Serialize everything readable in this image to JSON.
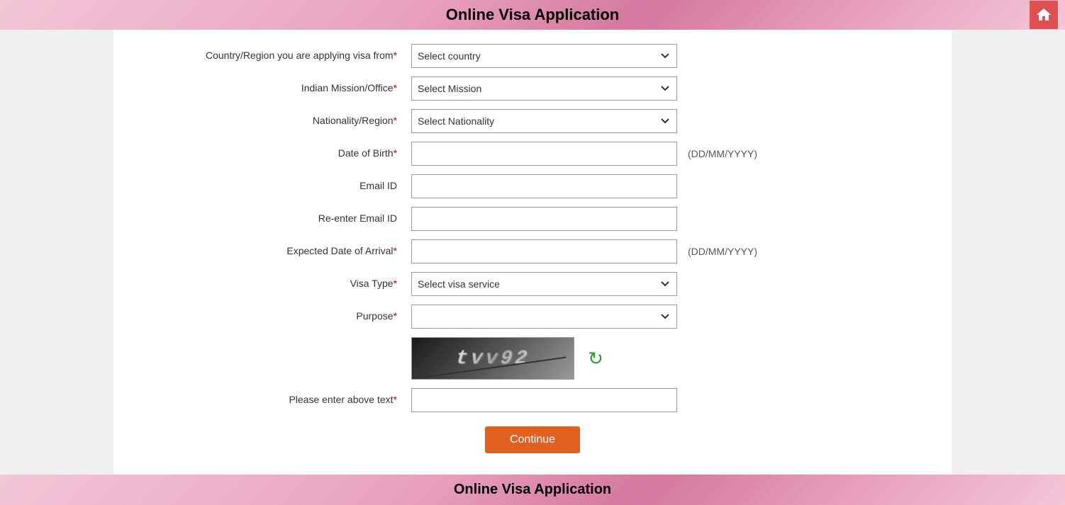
{
  "header": {
    "title": "Online Visa Application",
    "home_icon": "🏠"
  },
  "footer": {
    "title": "Online Visa Application"
  },
  "form": {
    "fields": [
      {
        "id": "country",
        "label": "Country/Region you are applying visa from",
        "required": true,
        "type": "select",
        "placeholder": "Select country",
        "date_hint": ""
      },
      {
        "id": "mission",
        "label": "Indian Mission/Office",
        "required": true,
        "type": "select",
        "placeholder": "Select Mission",
        "date_hint": ""
      },
      {
        "id": "nationality",
        "label": "Nationality/Region",
        "required": true,
        "type": "select",
        "placeholder": "Select Nationality",
        "date_hint": ""
      },
      {
        "id": "dob",
        "label": "Date of Birth",
        "required": true,
        "type": "text",
        "placeholder": "",
        "date_hint": "(DD/MM/YYYY)"
      },
      {
        "id": "email",
        "label": "Email ID",
        "required": false,
        "type": "text",
        "placeholder": "",
        "date_hint": ""
      },
      {
        "id": "email_re",
        "label": "Re-enter Email ID",
        "required": false,
        "type": "text",
        "placeholder": "",
        "date_hint": ""
      },
      {
        "id": "arrival",
        "label": "Expected Date of Arrival",
        "required": true,
        "type": "text",
        "placeholder": "",
        "date_hint": "(DD/MM/YYYY)"
      },
      {
        "id": "visa_type",
        "label": "Visa Type",
        "required": true,
        "type": "select",
        "placeholder": "Select visa service",
        "date_hint": ""
      },
      {
        "id": "purpose",
        "label": "Purpose",
        "required": true,
        "type": "select",
        "placeholder": "",
        "date_hint": ""
      }
    ],
    "captcha_text": "tvv92",
    "captcha_label": "Please enter above text",
    "captcha_required": true,
    "continue_label": "Continue"
  }
}
